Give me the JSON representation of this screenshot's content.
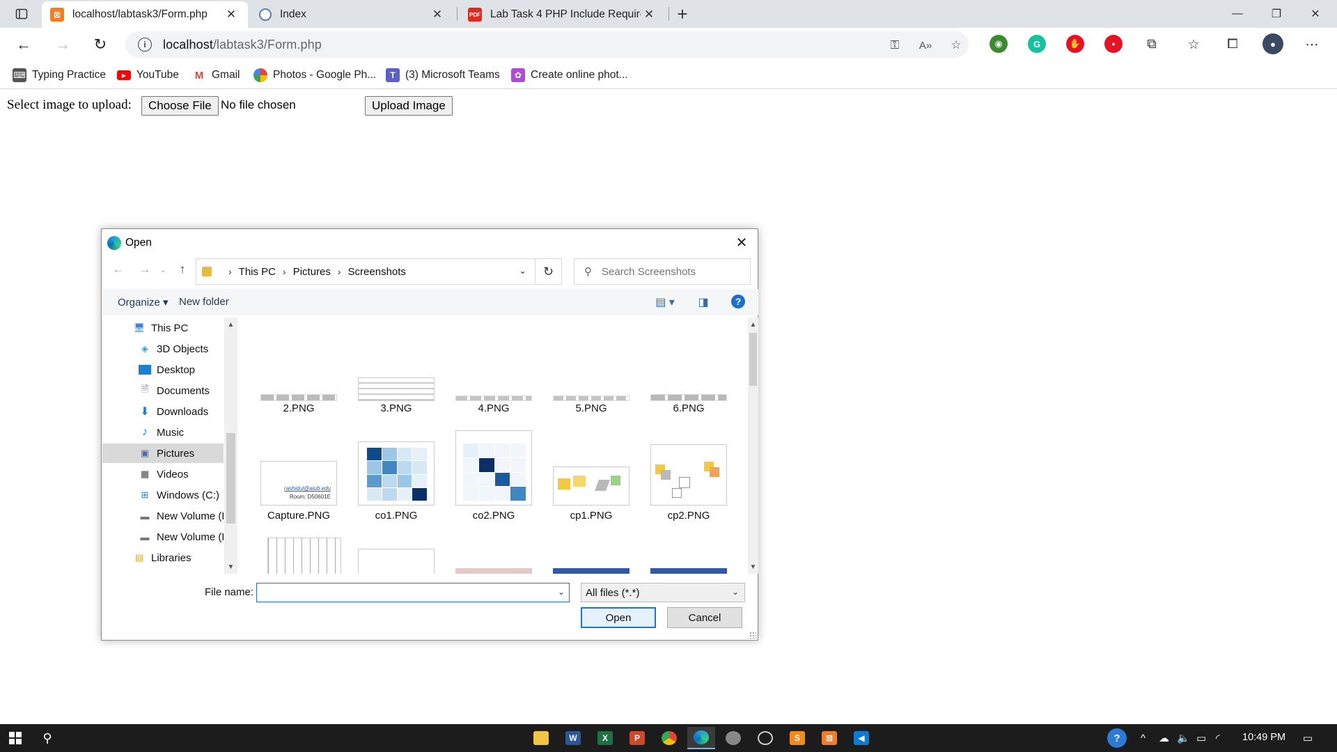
{
  "browser": {
    "tabs": [
      {
        "title": "localhost/labtask3/Form.php",
        "active": true,
        "favicon": "xampp-icon",
        "color": "#f27d26"
      },
      {
        "title": "Index",
        "active": false,
        "favicon": "globe-icon"
      },
      {
        "title": "Lab Task 4 PHP Include Require v",
        "active": false,
        "favicon": "pdf-icon",
        "color": "#e02a20"
      }
    ],
    "address": {
      "host": "localhost",
      "path": "/labtask3/Form.php"
    },
    "favorites": [
      {
        "label": "Typing Practice",
        "icon": "typing-icon"
      },
      {
        "label": "YouTube",
        "icon": "youtube-icon",
        "color": "#ff0000"
      },
      {
        "label": "Gmail",
        "icon": "gmail-icon",
        "color": "#ea4335"
      },
      {
        "label": "Photos - Google Ph...",
        "icon": "photos-icon"
      },
      {
        "label": "(3) Microsoft Teams",
        "icon": "teams-icon",
        "color": "#5b5fc7"
      },
      {
        "label": "Create online phot...",
        "icon": "photo-editor-icon",
        "color": "#b04bd6"
      }
    ]
  },
  "page": {
    "upload_label": "Select image to upload:",
    "choose_file": "Choose File",
    "no_file": "No file chosen",
    "upload_button": "Upload Image"
  },
  "dialog": {
    "title": "Open",
    "breadcrumb": [
      "This PC",
      "Pictures",
      "Screenshots"
    ],
    "search_placeholder": "Search Screenshots",
    "organize": "Organize",
    "new_folder": "New folder",
    "nav_items": [
      {
        "label": "This PC",
        "icon": "computer-icon"
      },
      {
        "label": "3D Objects",
        "icon": "3d-objects-icon"
      },
      {
        "label": "Desktop",
        "icon": "desktop-icon"
      },
      {
        "label": "Documents",
        "icon": "documents-icon"
      },
      {
        "label": "Downloads",
        "icon": "downloads-icon"
      },
      {
        "label": "Music",
        "icon": "music-icon"
      },
      {
        "label": "Pictures",
        "icon": "pictures-icon",
        "selected": true
      },
      {
        "label": "Videos",
        "icon": "videos-icon"
      },
      {
        "label": "Windows (C:)",
        "icon": "drive-icon"
      },
      {
        "label": "New Volume (D",
        "icon": "drive-icon"
      },
      {
        "label": "New Volume (E",
        "icon": "drive-icon"
      },
      {
        "label": "Libraries",
        "icon": "libraries-icon"
      }
    ],
    "files": [
      {
        "name": "2.PNG"
      },
      {
        "name": "3.PNG"
      },
      {
        "name": "4.PNG"
      },
      {
        "name": "5.PNG"
      },
      {
        "name": "6.PNG"
      },
      {
        "name": "Capture.PNG",
        "thumb_text": [
          "rashidul@aiub.edu",
          "Room: D50601E"
        ]
      },
      {
        "name": "co1.PNG"
      },
      {
        "name": "co2.PNG"
      },
      {
        "name": "cp1.PNG"
      },
      {
        "name": "cp2.PNG"
      }
    ],
    "file_name_label": "File name:",
    "file_name_value": "",
    "filter": "All files (*.*)",
    "open_button": "Open",
    "cancel_button": "Cancel"
  },
  "taskbar": {
    "apps": [
      "file-explorer-icon",
      "word-icon",
      "excel-icon",
      "powerpoint-icon",
      "chrome-icon",
      "edge-icon",
      "app-icon",
      "app-icon",
      "sublime-icon",
      "xampp-icon",
      "vscode-icon"
    ],
    "time": "10:49 PM"
  }
}
